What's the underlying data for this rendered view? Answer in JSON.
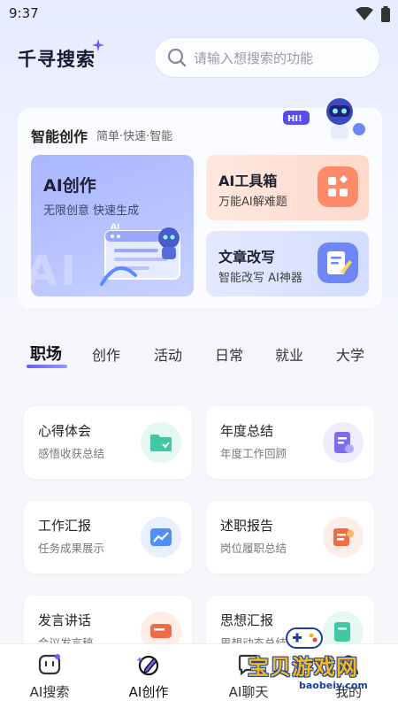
{
  "status": {
    "time": "9:37"
  },
  "header": {
    "title": "千寻搜索",
    "search_placeholder": "请输入想搜索的功能"
  },
  "robot": {
    "bubble": "HI!"
  },
  "creation": {
    "title": "智能创作",
    "subtitle": "简单·快速·智能",
    "ai_create": {
      "title": "AI创作",
      "subtitle": "无限创意 快速生成",
      "watermark": "AI CREATE",
      "chip": "AI"
    },
    "toolbox": {
      "title": "AI工具箱",
      "subtitle": "万能AI解难题"
    },
    "rewrite": {
      "title": "文章改写",
      "subtitle": "智能改写 AI神器"
    }
  },
  "tabs": [
    "职场",
    "创作",
    "活动",
    "日常",
    "就业",
    "大学"
  ],
  "active_tab": "职场",
  "cards": [
    {
      "title": "心得体会",
      "subtitle": "感悟收获总结",
      "icon": "folder-icon",
      "color": "#3fc8a2"
    },
    {
      "title": "年度总结",
      "subtitle": "年度工作回顾",
      "icon": "ai-document-icon",
      "color": "#7b6cf0"
    },
    {
      "title": "工作汇报",
      "subtitle": "任务成果展示",
      "icon": "chart-icon",
      "color": "#4f8ff7"
    },
    {
      "title": "述职报告",
      "subtitle": "岗位履职总结",
      "icon": "certificate-icon",
      "color": "#f36a46"
    },
    {
      "title": "发言讲话",
      "subtitle": "会议发言稿",
      "icon": "speech-icon",
      "color": "#f36a46"
    },
    {
      "title": "思想汇报",
      "subtitle": "思想动态总结",
      "icon": "notebook-icon",
      "color": "#3fc8a2"
    }
  ],
  "bottom_nav": [
    {
      "label": "AI搜索",
      "icon": "chat-face-icon",
      "active": false
    },
    {
      "label": "AI创作",
      "icon": "pen-icon",
      "active": true
    },
    {
      "label": "AI聊天",
      "icon": "chat-bubble-icon",
      "active": false
    },
    {
      "label": "我的",
      "icon": "profile-icon",
      "active": false
    }
  ],
  "watermark": {
    "text": "宝贝游戏网",
    "url": "baobeiy.com"
  },
  "colors": {
    "accent": "#6a5cff",
    "active_tab_underline": "#6a5cff"
  }
}
